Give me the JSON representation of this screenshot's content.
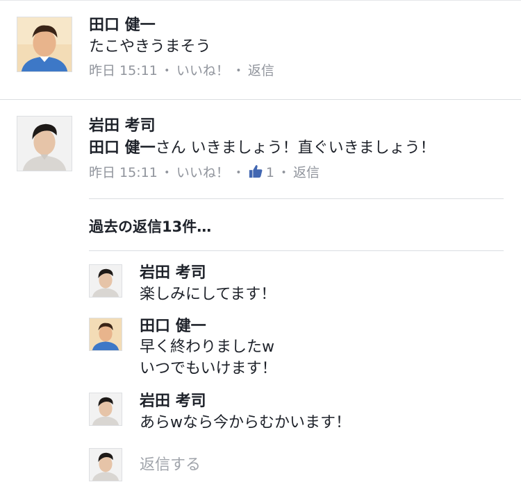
{
  "comments": [
    {
      "author": "田口 健一",
      "text": "たこやきうまそう",
      "time": "昨日 15:11",
      "like_label": "いいね！",
      "reply_label": "返信"
    },
    {
      "author": "岩田 考司",
      "mention": "田口 健一",
      "text": "さん いきましょう！直ぐいきましょう！",
      "time": "昨日 15:11",
      "like_label": "いいね！",
      "like_count": "1",
      "reply_label": "返信"
    }
  ],
  "previous_replies_label": "過去の返信13件…",
  "replies": [
    {
      "author": "岩田 考司",
      "lines": [
        "楽しみにしてます！"
      ]
    },
    {
      "author": "田口 健一",
      "lines": [
        "早く終わりましたw",
        "いつでもいけます！"
      ]
    },
    {
      "author": "岩田 考司",
      "lines": [
        "あらwなら今からむかいます！"
      ]
    }
  ],
  "reply_placeholder": "返信する",
  "separator": "・",
  "colors": {
    "meta": "#90949c",
    "like_blue": "#4267b2",
    "text": "#1d2129"
  }
}
